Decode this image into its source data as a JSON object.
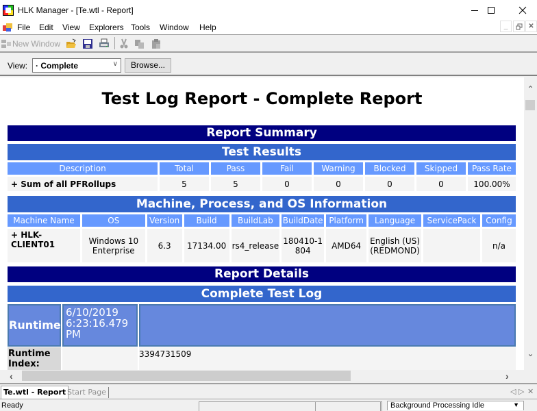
{
  "window": {
    "title": "HLK Manager - [Te.wtl - Report]",
    "controls": [
      "minimize",
      "maximize",
      "close"
    ]
  },
  "menu": {
    "items": [
      {
        "label": "File"
      },
      {
        "label": "Edit"
      },
      {
        "label": "View"
      },
      {
        "label": "Explorers"
      },
      {
        "label": "Tools"
      },
      {
        "label": "Window"
      },
      {
        "label": "Help"
      }
    ]
  },
  "toolbar": {
    "new_window_label": "New Window",
    "icons": [
      "new-window-icon",
      "open-folder-icon",
      "save-icon",
      "print-icon",
      "cut-icon",
      "copy-icon",
      "paste-icon"
    ]
  },
  "viewbar": {
    "label": "View:",
    "selected": "· Complete",
    "browse_label": "Browse..."
  },
  "report": {
    "title": "Test Log Report - Complete Report",
    "summary_header": "Report Summary",
    "test_results": {
      "header": "Test Results",
      "columns": [
        "Description",
        "Total",
        "Pass",
        "Fail",
        "Warning",
        "Blocked",
        "Skipped",
        "Pass Rate"
      ],
      "rows": [
        {
          "description": "+ Sum of all PFRollups",
          "total": "5",
          "pass": "5",
          "fail": "0",
          "warning": "0",
          "blocked": "0",
          "skipped": "0",
          "pass_rate": "100.00%"
        }
      ]
    },
    "machine_info": {
      "header": "Machine, Process, and OS Information",
      "columns": [
        "Machine Name",
        "OS",
        "Version",
        "Build",
        "BuildLab",
        "BuildDate",
        "Platform",
        "Language",
        "ServicePack",
        "Config"
      ],
      "rows": [
        {
          "machine_name": "+ HLK-CLIENT01",
          "os": "Windows 10 Enterprise",
          "version": "6.3",
          "build": "17134.00",
          "buildlab": "rs4_release",
          "builddate": "180410-1804",
          "platform": "AMD64",
          "language": "English (US) (REDMOND)",
          "servicepack": "",
          "config": "n/a"
        }
      ]
    },
    "details_header": "Report Details",
    "complete_log": {
      "header": "Complete Test Log",
      "runtime_label": "Runtime",
      "runtime_value": "6/10/2019 6:23:16.479 PM",
      "runtime_index_label": "Runtime Index:",
      "runtime_index_value": "3394731509"
    }
  },
  "tabs": [
    {
      "label": "Te.wtl - Report",
      "active": true
    },
    {
      "label": "Start Page",
      "active": false
    }
  ],
  "status": {
    "text": "Ready",
    "background_processing": "Background Processing Idle"
  },
  "colors": {
    "dark_header": "#000080",
    "mid_header": "#3366CC",
    "column_header": "#6699FF",
    "row_bg": "#F4F4F4",
    "log_cell": "#6688DD"
  }
}
